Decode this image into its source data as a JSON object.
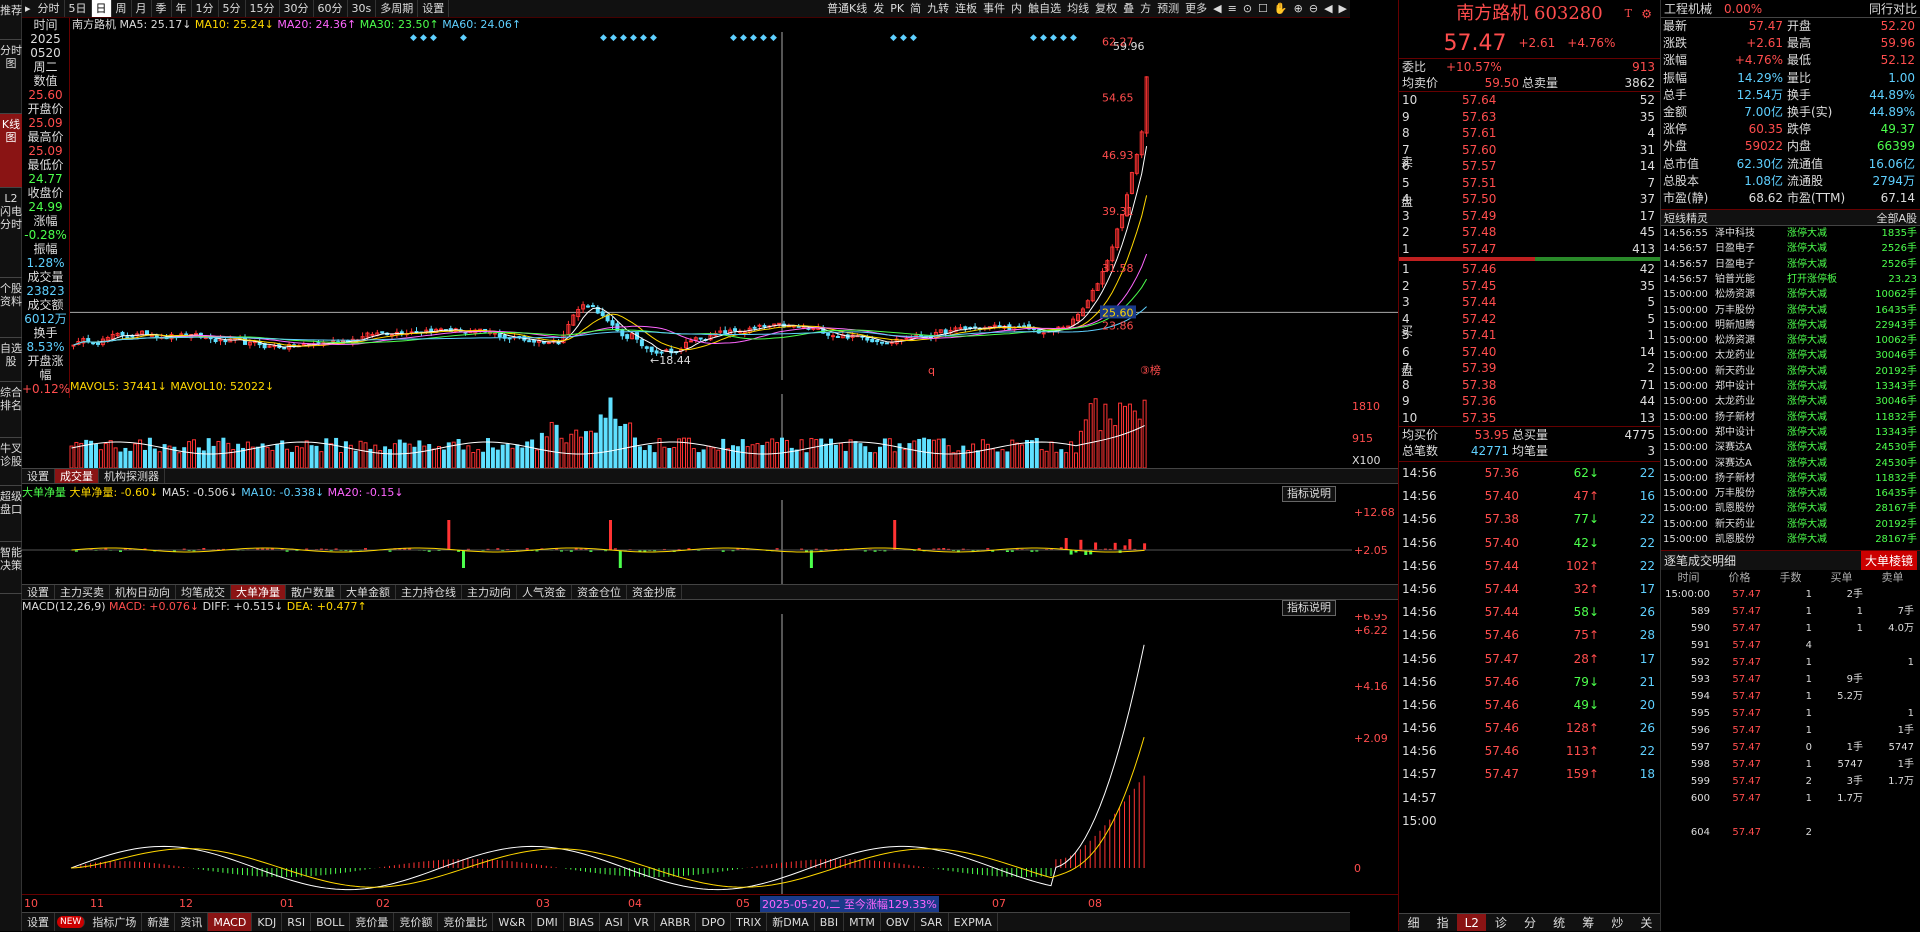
{
  "left_nav": [
    "推荐",
    "分时图",
    "K线图",
    "L2闪电分时",
    "个股资料",
    "自选股",
    "综合排名",
    "牛叉诊股",
    "超级盘口",
    "智能决策"
  ],
  "toolbar": {
    "items": [
      "分时",
      "5日",
      "日",
      "周",
      "月",
      "季",
      "年",
      "1分",
      "5分",
      "15分",
      "30分",
      "60分",
      "30s",
      "多周期",
      "设置"
    ],
    "active": "日",
    "right_items": [
      "普通K线",
      "发",
      "PK",
      "简",
      "九转",
      "连板",
      "事件",
      "内",
      "触自选",
      "均线",
      "复权",
      "叠",
      "方",
      "预测",
      "更多"
    ]
  },
  "info": [
    {
      "label": "时间",
      "value": "2025",
      "c": ""
    },
    {
      "label": "",
      "value": "0520",
      "c": ""
    },
    {
      "label": "",
      "value": "周二",
      "c": ""
    },
    {
      "label": "数值",
      "value": "25.60",
      "c": "red"
    },
    {
      "label": "开盘价",
      "value": "25.09",
      "c": "red"
    },
    {
      "label": "最高价",
      "value": "25.09",
      "c": "red"
    },
    {
      "label": "最低价",
      "value": "24.77",
      "c": "green"
    },
    {
      "label": "收盘价",
      "value": "24.99",
      "c": "green"
    },
    {
      "label": "涨幅",
      "value": "-0.28%",
      "c": "green"
    },
    {
      "label": "振幅",
      "value": "1.28%",
      "c": "cyan"
    },
    {
      "label": "成交量",
      "value": "23823",
      "c": "cyan"
    },
    {
      "label": "成交额",
      "value": "6012万",
      "c": "cyan"
    },
    {
      "label": "换手",
      "value": "8.53%",
      "c": "cyan"
    },
    {
      "label": "开盘涨幅",
      "value": "+0.12%",
      "c": "red"
    }
  ],
  "main_chart": {
    "ma_legend": [
      {
        "t": "南方路机",
        "c": "#ddd"
      },
      {
        "t": "MA5: 25.17↓",
        "c": "#ddd"
      },
      {
        "t": "MA10: 25.24↓",
        "c": "#ffd700"
      },
      {
        "t": "MA20: 24.36↑",
        "c": "#ff66ff"
      },
      {
        "t": "MA30: 23.50↑",
        "c": "#4cff4c"
      },
      {
        "t": "MA60: 24.06↑",
        "c": "#5fd0ff"
      }
    ],
    "y_ticks": [
      "62.27",
      "54.65",
      "46.93",
      "39.31",
      "31.58",
      "25.60",
      "23.86"
    ],
    "high_label": "59.96",
    "low_label": "18.44",
    "crosshair_value": "25.60",
    "marker_q": "q",
    "marker_bang": "③榜"
  },
  "volume_chart": {
    "legend": [
      "MAVOL5: 37441↓",
      "MAVOL10: 52022↓"
    ],
    "y_ticks": [
      "1810",
      "915",
      "X100"
    ]
  },
  "vol_tabs": [
    "设置",
    "成交量",
    "机构探测器"
  ],
  "dadan": {
    "legend": [
      "大单净量",
      "大单净量: -0.60↓",
      "MA5: -0.506↓",
      "MA10: -0.338↓",
      "MA20: -0.15↓"
    ],
    "y_ticks": [
      "+12.68",
      "+2.05"
    ],
    "help": "指标说明"
  },
  "dadan_tabs": [
    "设置",
    "主力买卖",
    "机构日动向",
    "均笔成交",
    "大单净量",
    "散户数量",
    "大单金额",
    "主力持仓线",
    "主力动向",
    "人气资金",
    "资金仓位",
    "资金抄底"
  ],
  "macd": {
    "legend": [
      "MACD(12,26,9)",
      "MACD: +0.076↓",
      "DIFF: +0.515↓",
      "DEA: +0.477↑"
    ],
    "y_ticks": [
      "+6.95",
      "+6.22",
      "+4.16",
      "+2.09",
      "0"
    ],
    "help": "指标说明"
  },
  "x_axis": [
    "10",
    "11",
    "12",
    "01",
    "02",
    "03",
    "04",
    "05",
    "06",
    "07",
    "08"
  ],
  "crosshair_date": "2025-05-20,二 至今涨幅129.33%",
  "bottom_tabs": [
    "设置",
    "NEW",
    "指标广场",
    "新建",
    "资讯",
    "MACD",
    "KDJ",
    "RSI",
    "BOLL",
    "竞价量",
    "竞价额",
    "竞价量比",
    "W&R",
    "DMI",
    "BIAS",
    "ASI",
    "VR",
    "ARBR",
    "DPO",
    "TRIX",
    "新DMA",
    "BBI",
    "MTM",
    "OBV",
    "SAR",
    "EXPMA"
  ],
  "quote": {
    "name": "南方路机 603280",
    "price": "57.47",
    "change": "+2.61",
    "pct": "+4.76%",
    "weibi_label": "委比",
    "weibi": "+10.57%",
    "weibi_v": "913",
    "avg_sell_label": "均卖价",
    "avg_sell": "59.50",
    "total_sell_label": "总卖量",
    "total_sell": "3862",
    "sell_label": "卖盘",
    "buy_label": "买盘",
    "asks": [
      [
        "10",
        "57.64",
        "52"
      ],
      [
        "9",
        "57.63",
        "35"
      ],
      [
        "8",
        "57.61",
        "4"
      ],
      [
        "7",
        "57.60",
        "31"
      ],
      [
        "6",
        "57.57",
        "14"
      ],
      [
        "5",
        "57.51",
        "7"
      ],
      [
        "4",
        "57.50",
        "37"
      ],
      [
        "3",
        "57.49",
        "17"
      ],
      [
        "2",
        "57.48",
        "45"
      ],
      [
        "1",
        "57.47",
        "413"
      ]
    ],
    "bids": [
      [
        "1",
        "57.46",
        "42"
      ],
      [
        "2",
        "57.45",
        "35"
      ],
      [
        "3",
        "57.44",
        "5"
      ],
      [
        "4",
        "57.42",
        "5"
      ],
      [
        "5",
        "57.41",
        "1"
      ],
      [
        "6",
        "57.40",
        "14"
      ],
      [
        "7",
        "57.39",
        "2"
      ],
      [
        "8",
        "57.38",
        "71"
      ],
      [
        "9",
        "57.36",
        "44"
      ],
      [
        "10",
        "57.35",
        "13"
      ]
    ],
    "avg_buy_label": "均买价",
    "avg_buy": "53.95",
    "total_buy_label": "总买量",
    "total_buy": "4775",
    "total_trades_label": "总笔数",
    "total_trades": "42771",
    "avg_trade_label": "均笔量",
    "avg_trade": "3",
    "ticks": [
      [
        "14:56",
        "57.36",
        "62↓",
        "22"
      ],
      [
        "14:56",
        "57.40",
        "47↑",
        "16"
      ],
      [
        "14:56",
        "57.38",
        "77↓",
        "22"
      ],
      [
        "14:56",
        "57.40",
        "42↓",
        "22"
      ],
      [
        "14:56",
        "57.44",
        "102↑",
        "22"
      ],
      [
        "14:56",
        "57.44",
        "32↑",
        "17"
      ],
      [
        "14:56",
        "57.44",
        "58↓",
        "26"
      ],
      [
        "14:56",
        "57.46",
        "75↑",
        "28"
      ],
      [
        "14:56",
        "57.47",
        "28↑",
        "17"
      ],
      [
        "14:56",
        "57.46",
        "79↓",
        "21"
      ],
      [
        "14:56",
        "57.46",
        "49↓",
        "20"
      ],
      [
        "14:56",
        "57.46",
        "128↑",
        "26"
      ],
      [
        "14:56",
        "57.46",
        "113↑",
        "22"
      ],
      [
        "14:57",
        "57.47",
        "159↑",
        "18"
      ],
      [
        "14:57",
        "",
        "",
        ""
      ],
      [
        "15:00",
        "",
        "",
        ""
      ]
    ],
    "bottom_tabs": [
      "细",
      "指",
      "L2",
      "诊",
      "分",
      "统",
      "筹",
      "炒",
      "关"
    ],
    "bottom_active": "L2"
  },
  "right": {
    "sector_name": "工程机械",
    "sector_pct": "0.00%",
    "sector_btn": "同行对比",
    "stats": [
      [
        "最新",
        "57.47",
        "开盘",
        "52.20",
        "r",
        "r"
      ],
      [
        "涨跌",
        "+2.61",
        "最高",
        "59.96",
        "r",
        "r"
      ],
      [
        "涨幅",
        "+4.76%",
        "最低",
        "52.12",
        "r",
        "r"
      ],
      [
        "振幅",
        "14.29%",
        "量比",
        "1.00",
        "c",
        "c"
      ],
      [
        "总手",
        "12.54万",
        "换手",
        "44.89%",
        "c",
        "c"
      ],
      [
        "金额",
        "7.00亿",
        "换手(实)",
        "44.89%",
        "c",
        "c"
      ],
      [
        "涨停",
        "60.35",
        "跌停",
        "49.37",
        "r",
        "g"
      ],
      [
        "外盘",
        "59022",
        "内盘",
        "66399",
        "r",
        "g"
      ],
      [
        "总市值",
        "62.30亿",
        "流通值",
        "16.06亿",
        "c",
        "c"
      ],
      [
        "总股本",
        "1.08亿",
        "流通股",
        "2794万",
        "c",
        "c"
      ],
      [
        "市盈(静)",
        "68.62",
        "市盈(TTM)",
        "67.14",
        "w",
        "w"
      ]
    ],
    "short_title": "短线精灵",
    "short_filter": "全部A股",
    "short_rows": [
      [
        "14:56:55",
        "泽中科技",
        "涨停大减",
        "1835手"
      ],
      [
        "14:56:57",
        "日盈电子",
        "涨停大减",
        "2526手"
      ],
      [
        "14:56:57",
        "日盈电子",
        "涨停大减",
        "2526手"
      ],
      [
        "14:56:57",
        "铂普光能",
        "打开涨停板",
        "23.23"
      ],
      [
        "15:00:00",
        "松炀资源",
        "涨停大减",
        "10062手"
      ],
      [
        "15:00:00",
        "万丰股份",
        "涨停大减",
        "16435手"
      ],
      [
        "15:00:00",
        "明新旭腾",
        "涨停大减",
        "22943手"
      ],
      [
        "15:00:00",
        "松炀资源",
        "涨停大减",
        "10062手"
      ],
      [
        "15:00:00",
        "太龙药业",
        "涨停大减",
        "30046手"
      ],
      [
        "15:00:00",
        "新天药业",
        "涨停大减",
        "20192手"
      ],
      [
        "15:00:00",
        "郑中设计",
        "涨停大减",
        "13343手"
      ],
      [
        "15:00:00",
        "太龙药业",
        "涨停大减",
        "30046手"
      ],
      [
        "15:00:00",
        "扬子新材",
        "涨停大减",
        "11832手"
      ],
      [
        "15:00:00",
        "郑中设计",
        "涨停大减",
        "13343手"
      ],
      [
        "15:00:00",
        "深赛达A",
        "涨停大减",
        "24530手"
      ],
      [
        "15:00:00",
        "深赛达A",
        "涨停大减",
        "24530手"
      ],
      [
        "15:00:00",
        "扬子新材",
        "涨停大减",
        "11832手"
      ],
      [
        "15:00:00",
        "万丰股份",
        "涨停大减",
        "16435手"
      ],
      [
        "15:00:00",
        "凯恩股份",
        "涨停大减",
        "28167手"
      ],
      [
        "15:00:00",
        "新天药业",
        "涨停大减",
        "20192手"
      ],
      [
        "15:00:00",
        "凯恩股份",
        "涨停大减",
        "28167手"
      ]
    ],
    "detail_title": "逐笔成交明细",
    "detail_btn": "大单棱镜",
    "detail_headers": [
      "时间",
      "价格",
      "手数",
      "买单",
      "卖单"
    ],
    "detail_rows": [
      [
        "15:00:00",
        "57.47",
        "1",
        "2手",
        ""
      ],
      [
        "589",
        "57.47",
        "1",
        "1",
        "7手"
      ],
      [
        "590",
        "57.47",
        "1",
        "1",
        "4.0万"
      ],
      [
        "591",
        "57.47",
        "4",
        "",
        ""
      ],
      [
        "592",
        "57.47",
        "1",
        "",
        "1"
      ],
      [
        "593",
        "57.47",
        "1",
        "9手",
        ""
      ],
      [
        "594",
        "57.47",
        "1",
        "5.2万",
        ""
      ],
      [
        "595",
        "57.47",
        "1",
        "",
        "1"
      ],
      [
        "596",
        "57.47",
        "1",
        "",
        "1手"
      ],
      [
        "597",
        "57.47",
        "0",
        "1手",
        "5747"
      ],
      [
        "598",
        "57.47",
        "1",
        "5747",
        "1手"
      ],
      [
        "599",
        "57.47",
        "2",
        "3手",
        "1.7万"
      ],
      [
        "600",
        "57.47",
        "1",
        "1.7万",
        ""
      ],
      [
        "",
        "",
        "",
        "",
        ""
      ],
      [
        "604",
        "57.47",
        "2",
        "",
        ""
      ]
    ]
  }
}
